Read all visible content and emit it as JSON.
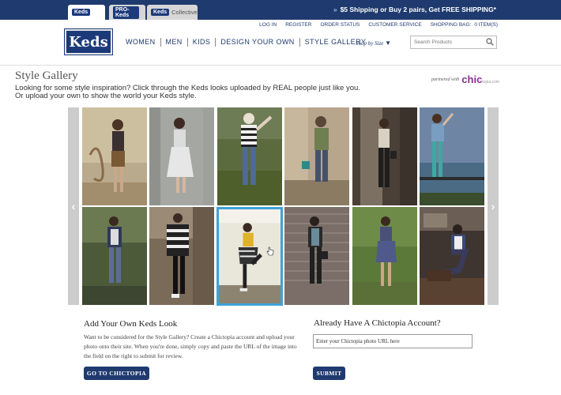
{
  "tabs": [
    {
      "logo": "Keds",
      "label": ""
    },
    {
      "logo": "PRO-Keds",
      "label": ""
    },
    {
      "logo": "Keds",
      "label": "Collective"
    }
  ],
  "promo": "$5 Shipping or Buy 2 pairs, Get FREE SHIPPING*",
  "logo_text": "Keds",
  "utility_links": [
    "LOG IN",
    "REGISTER",
    "ORDER STATUS",
    "CUSTOMER SERVICE",
    "SHOPPING BAG:",
    "0  ITEM(S)"
  ],
  "nav": [
    "WOMEN",
    "MEN",
    "KIDS",
    "DESIGN YOUR OWN",
    "STYLE GALLERY"
  ],
  "shop_by_size": "Shop by Size",
  "search": {
    "placeholder": "Search Products"
  },
  "page_title": "Style Gallery",
  "intro": [
    "Looking for some style inspiration? Click through the Keds looks uploaded by REAL people just like you.",
    "Or upload your own to show the world your Keds style."
  ],
  "partner": {
    "prefix": "partnered with",
    "brand": "chic",
    "suffix": "topia.com"
  },
  "gallery": {
    "selected_index": 8,
    "photo_count": 12
  },
  "add_look": {
    "title": "Add Your Own Keds Look",
    "description": "Want to be considered for the Style Gallery? Create a Chictopia account and upload your photo onto their site. When you're done, simply copy and paste the URL of the image into the field on the right to submit for review.",
    "button": "GO TO CHICTOPIA"
  },
  "have_account": {
    "title": "Already Have A Chictopia Account?",
    "url_value": "Enter your Chictopia photo URL here",
    "button": "SUBMIT"
  },
  "colors": {
    "brand": "#1f3a6e",
    "selected": "#3ea2d8",
    "chic": "#8a2f8c"
  }
}
